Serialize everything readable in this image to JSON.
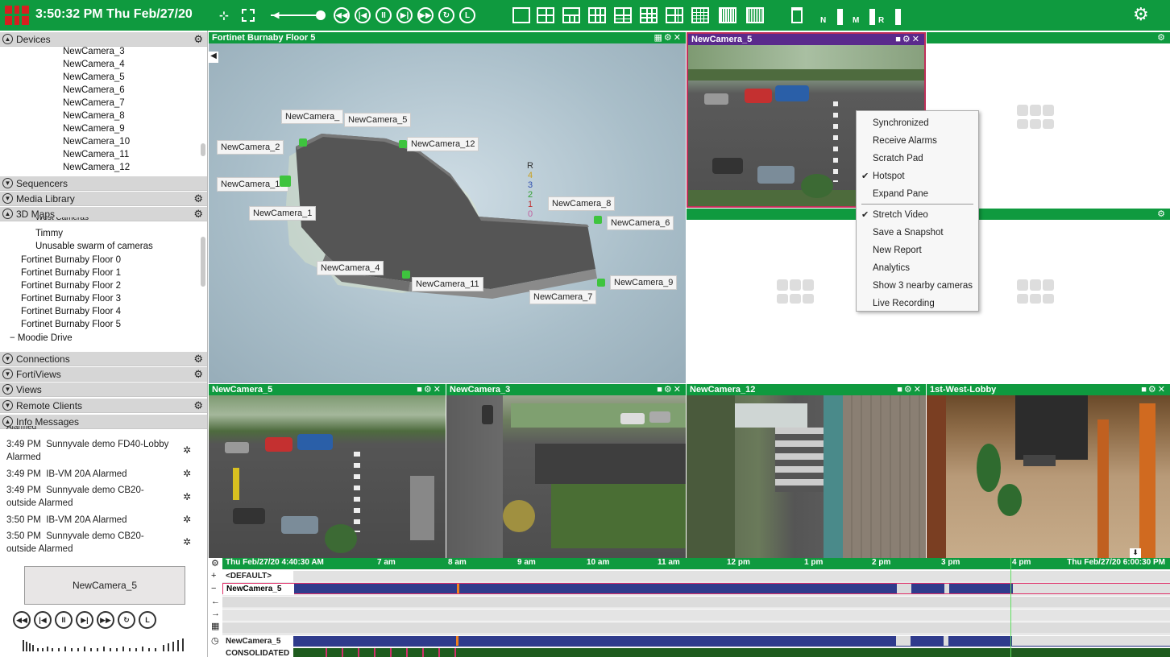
{
  "toolbar": {
    "clock": "3:50:32 PM Thu Feb/27/20",
    "indicators": [
      {
        "letter": "N",
        "label": "network-bandwidth"
      },
      {
        "letter": "M",
        "label": "memory-usage"
      },
      {
        "letter": "R",
        "label": "recording"
      }
    ]
  },
  "sidebar": {
    "devices_label": "Devices",
    "devices": [
      "NewCamera_3",
      "NewCamera_4",
      "NewCamera_5",
      "NewCamera_6",
      "NewCamera_7",
      "NewCamera_8",
      "NewCamera_9",
      "NewCamera_10",
      "NewCamera_11",
      "NewCamera_12"
    ],
    "sequencers_label": "Sequencers",
    "media_label": "Media Library",
    "maps_label": "3D Maps",
    "maps": [
      "Timmy",
      "Unusable swarm of cameras",
      "Fortinet Burnaby Floor 0",
      "Fortinet Burnaby Floor 1",
      "Fortinet Burnaby Floor 2",
      "Fortinet Burnaby Floor 3",
      "Fortinet Burnaby Floor 4",
      "Fortinet Burnaby Floor 5",
      "Moodie Drive"
    ],
    "maps_cut_top": "West Cameras",
    "connections_label": "Connections",
    "fortiviews_label": "FortiViews",
    "views_label": "Views",
    "remote_label": "Remote Clients",
    "info_label": "Info Messages",
    "info_cut_top": "Alarmed",
    "messages": [
      {
        "time": "3:49 PM",
        "text": "Sunnyvale demo FD40-Lobby",
        "text2": "Alarmed"
      },
      {
        "time": "3:49 PM",
        "text": "IB-VM 20A Alarmed",
        "text2": ""
      },
      {
        "time": "3:49 PM",
        "text": "Sunnyvale demo CB20-",
        "text2": "outside Alarmed"
      },
      {
        "time": "3:50 PM",
        "text": "IB-VM 20A Alarmed",
        "text2": ""
      },
      {
        "time": "3:50 PM",
        "text": "Sunnyvale demo CB20-",
        "text2": "outside Alarmed"
      }
    ]
  },
  "bottom_left": {
    "camera_name": "NewCamera_5",
    "playback": [
      "◀◀",
      "|◀",
      "II",
      "▶|",
      "▶▶",
      "↻",
      "L"
    ]
  },
  "panes": {
    "map": {
      "title": "Fortinet Burnaby Floor 5",
      "cameras": [
        "NewCamera_",
        "NewCamera_5",
        "NewCamera_12",
        "NewCamera_2",
        "NewCamera_10",
        "NewCamera_1",
        "NewCamera_8",
        "NewCamera_6",
        "NewCamera_4",
        "NewCamera_11",
        "NewCamera_9",
        "NewCamera_7"
      ],
      "floors": [
        "R",
        "4",
        "3",
        "2",
        "1",
        "0"
      ]
    },
    "top_cam": {
      "title": "NewCamera_5"
    },
    "bottom": [
      {
        "title": "NewCamera_5"
      },
      {
        "title": "NewCamera_3"
      },
      {
        "title": "NewCamera_12"
      },
      {
        "title": "1st-West-Lobby"
      }
    ]
  },
  "context_menu": {
    "items": [
      {
        "label": "Synchronized",
        "checked": false
      },
      {
        "label": "Receive Alarms",
        "checked": false
      },
      {
        "label": "Scratch Pad",
        "checked": false
      },
      {
        "label": "Hotspot",
        "checked": true
      },
      {
        "label": "Expand Pane",
        "checked": false
      },
      {
        "label": "Stretch Video",
        "checked": true
      },
      {
        "label": "Save a Snapshot",
        "checked": false
      },
      {
        "label": "New Report",
        "checked": false
      },
      {
        "label": "Analytics",
        "checked": false
      },
      {
        "label": "Show 3 nearby cameras",
        "checked": false
      },
      {
        "label": "Live Recording",
        "checked": false
      }
    ]
  },
  "timeline": {
    "start": "Thu Feb/27/20 4:40:30 AM",
    "end": "Thu Feb/27/20 6:00:30 PM",
    "ticks": [
      "7 am",
      "8 am",
      "9 am",
      "10 am",
      "11 am",
      "12 pm",
      "1 pm",
      "2 pm",
      "3 pm",
      "4 pm"
    ],
    "rows": {
      "default": "<DEFAULT>",
      "camera": "NewCamera_5",
      "camera2": "NewCamera_5",
      "consolidated": "CONSOLIDATED"
    },
    "left_icons": [
      "+",
      "−",
      "←",
      "→",
      "▦",
      "◷"
    ]
  },
  "colors": {
    "brand_green": "#0f9a3f",
    "recording_blue": "#2f3b8c",
    "alarm_red": "#d42020"
  }
}
